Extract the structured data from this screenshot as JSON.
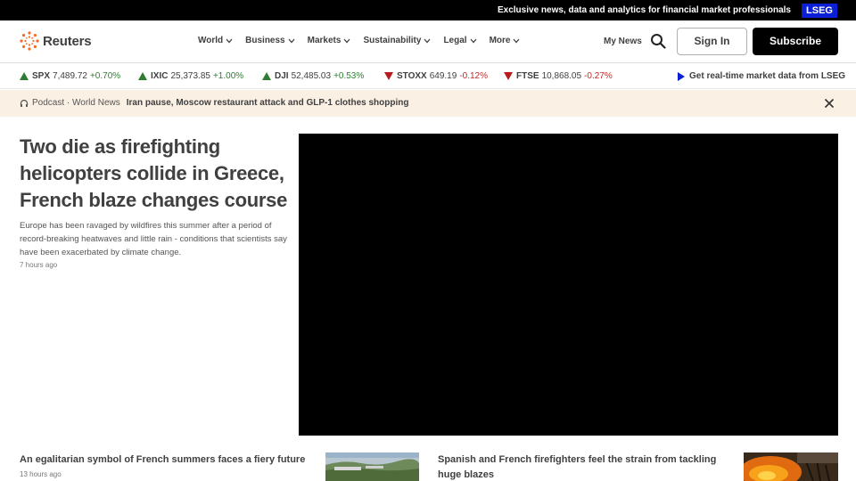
{
  "topbar": {
    "message": "Exclusive news, data and analytics for financial market professionals",
    "lseg": "LSEG"
  },
  "header": {
    "logo_text": "Reuters",
    "nav": [
      "World",
      "Business",
      "Markets",
      "Sustainability",
      "Legal",
      "More"
    ],
    "my_news": "My News",
    "sign_in": "Sign In",
    "subscribe": "Subscribe"
  },
  "ticker": [
    {
      "symbol": "SPX",
      "value": "7,489.72",
      "change": "+0.70%",
      "direction": "up"
    },
    {
      "symbol": "IXIC",
      "value": "25,373.85",
      "change": "+1.00%",
      "direction": "up"
    },
    {
      "symbol": "DJI",
      "value": "52,485.03",
      "change": "+0.53%",
      "direction": "up"
    },
    {
      "symbol": "STOXX",
      "value": "649.19",
      "change": "-0.12%",
      "direction": "down"
    },
    {
      "symbol": "FTSE",
      "value": "10,868.05",
      "change": "-0.27%",
      "direction": "down"
    }
  ],
  "lseg_link": "Get real-time market data from LSEG",
  "podcast": {
    "label": "Podcast · World News",
    "title": "Iran pause, Moscow restaurant attack and GLP-1 clothes shopping"
  },
  "hero": {
    "title": "Two die as firefighting helicopters collide in Greece, French blaze changes course",
    "description": "Europe has been ravaged by wildfires this summer after a period of record-breaking heatwaves and little rain - conditions that scientists say have been exacerbated by climate change.",
    "time": "7 hours ago"
  },
  "cards": [
    {
      "title": "An egalitarian symbol of French summers faces a fiery future",
      "time": "13 hours ago"
    },
    {
      "title": "Spanish and French firefighters feel the strain from tackling huge blazes"
    }
  ],
  "colors": {
    "brand_orange": "#f26b21",
    "lseg_blue": "#0a1fd6",
    "up": "#2e7d32",
    "down": "#c62828",
    "podcast_bg": "#fbf0e4"
  }
}
